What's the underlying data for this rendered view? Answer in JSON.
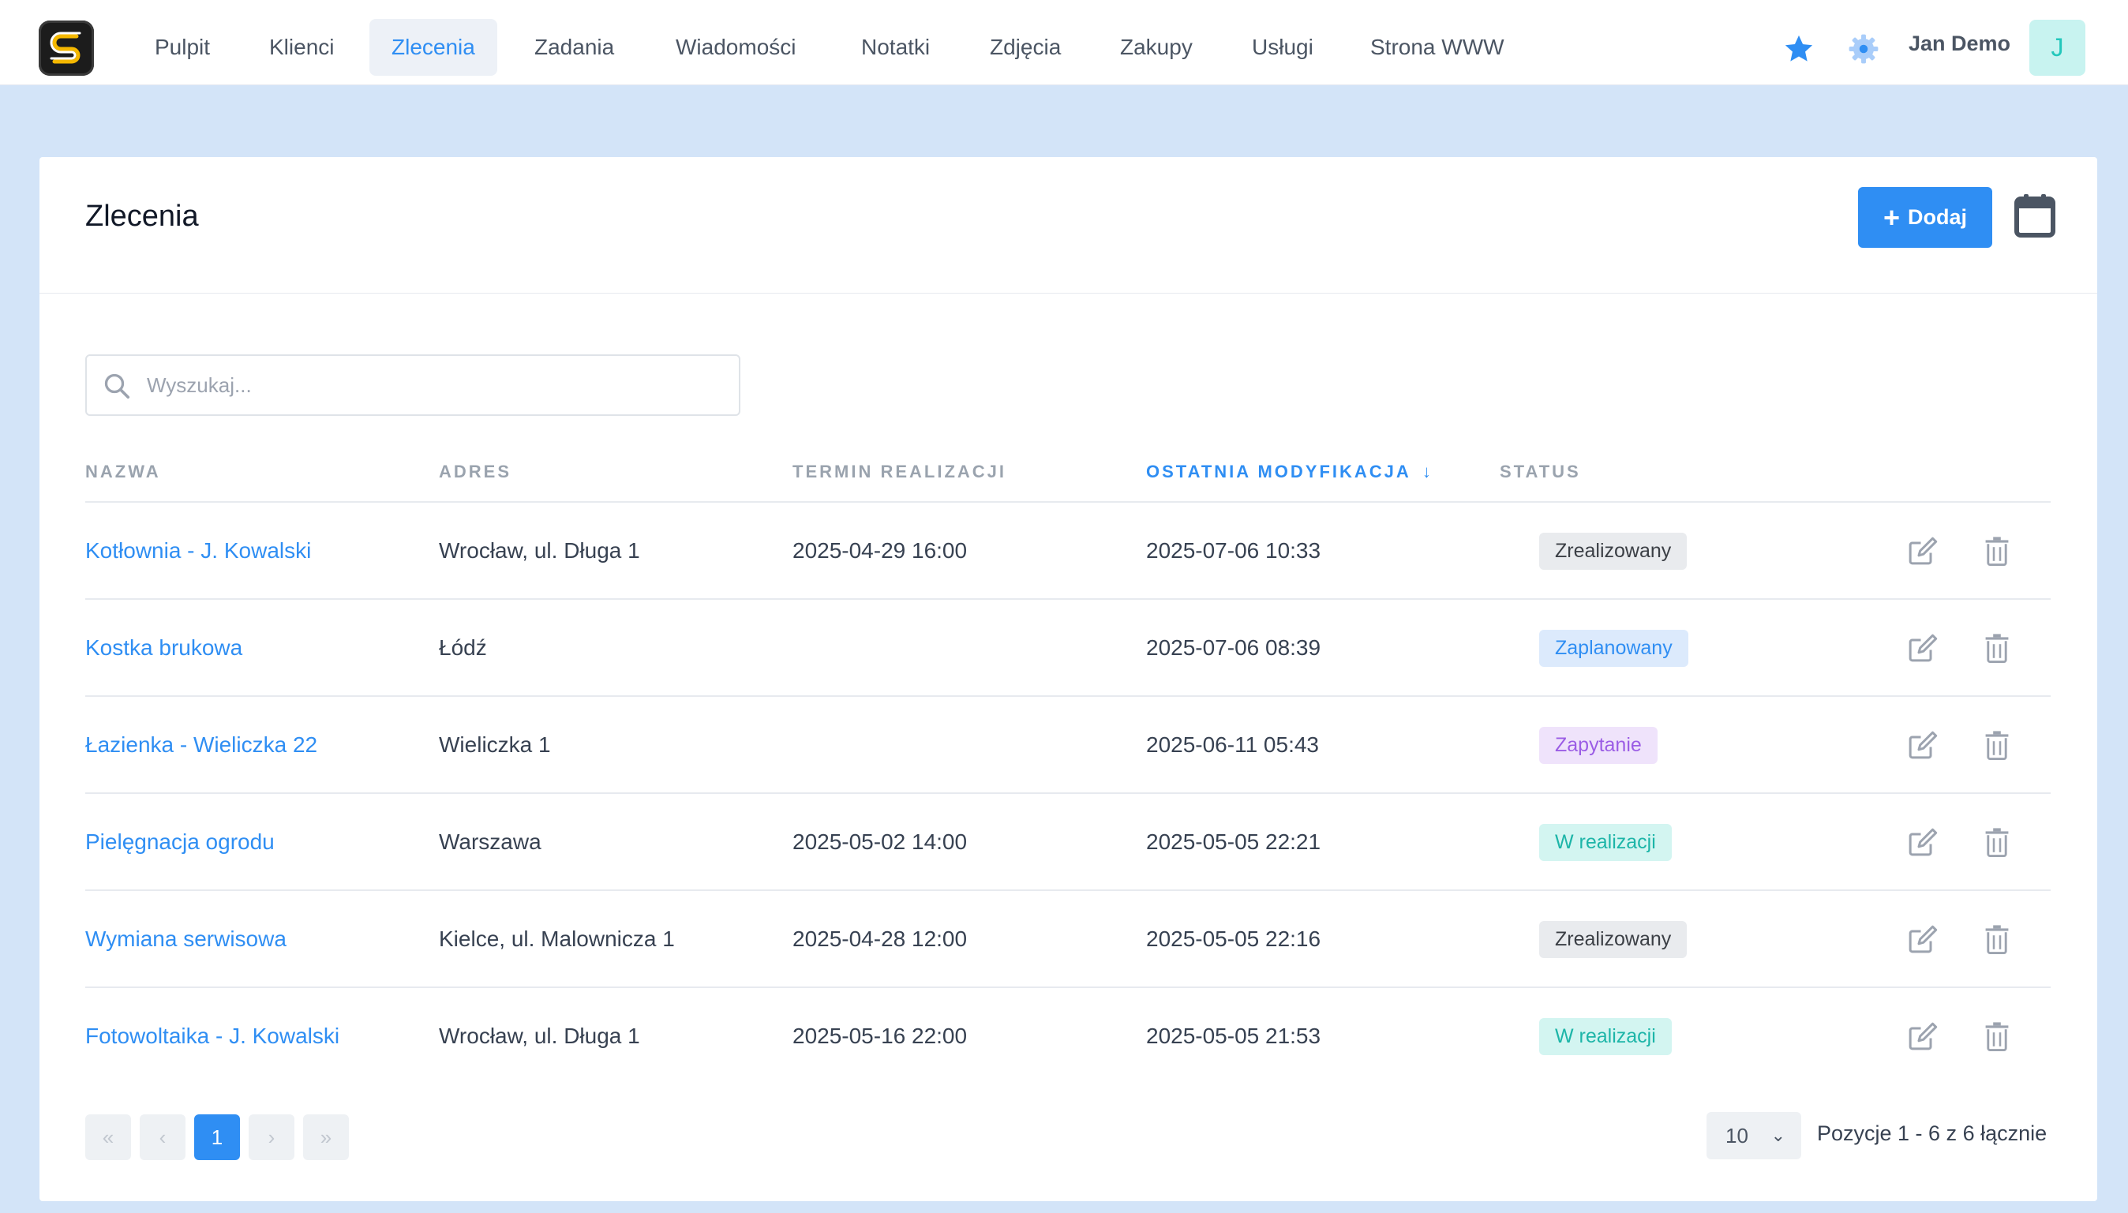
{
  "nav": {
    "items": [
      {
        "label": "Pulpit",
        "active": false
      },
      {
        "label": "Klienci",
        "active": false
      },
      {
        "label": "Zlecenia",
        "active": true
      },
      {
        "label": "Zadania",
        "active": false
      },
      {
        "label": "Wiadomości",
        "active": false
      },
      {
        "label": "Notatki",
        "active": false
      },
      {
        "label": "Zdjęcia",
        "active": false
      },
      {
        "label": "Zakupy",
        "active": false
      },
      {
        "label": "Usługi",
        "active": false
      },
      {
        "label": "Strona WWW",
        "active": false
      }
    ],
    "user_name": "Jan Demo",
    "avatar_letter": "J",
    "icons": [
      "star-icon",
      "gear-icon"
    ]
  },
  "page": {
    "title": "Zlecenia",
    "add_label": "Dodaj",
    "search_placeholder": "Wyszukaj..."
  },
  "table": {
    "columns": [
      "NAZWA",
      "ADRES",
      "TERMIN REALIZACJI",
      "OSTATNIA MODYFIKACJA",
      "STATUS"
    ],
    "sorted_column": "OSTATNIA MODYFIKACJA",
    "rows": [
      {
        "name": "Kotłownia - J. Kowalski",
        "address": "Wrocław, ul. Długa 1",
        "term": "2025-04-29 16:00",
        "modified": "2025-07-06 10:33",
        "status": "Zrealizowany"
      },
      {
        "name": "Kostka brukowa",
        "address": "Łódź",
        "term": "",
        "modified": "2025-07-06 08:39",
        "status": "Zaplanowany"
      },
      {
        "name": "Łazienka - Wieliczka 22",
        "address": "Wieliczka 1",
        "term": "",
        "modified": "2025-06-11 05:43",
        "status": "Zapytanie"
      },
      {
        "name": "Pielęgnacja ogrodu",
        "address": "Warszawa",
        "term": "2025-05-02 14:00",
        "modified": "2025-05-05 22:21",
        "status": "W realizacji"
      },
      {
        "name": "Wymiana serwisowa",
        "address": "Kielce, ul. Malownicza 1",
        "term": "2025-04-28 12:00",
        "modified": "2025-05-05 22:16",
        "status": "Zrealizowany"
      },
      {
        "name": "Fotowoltaika - J. Kowalski",
        "address": "Wrocław, ul. Długa 1",
        "term": "2025-05-16 22:00",
        "modified": "2025-05-05 21:53",
        "status": "W realizacji"
      }
    ]
  },
  "pagination": {
    "first": "«",
    "prev": "‹",
    "current_page": "1",
    "next": "›",
    "last": "»",
    "page_size": "10",
    "info": "Pozycje 1 - 6 z 6 łącznie"
  },
  "colors": {
    "accent": "#2f8ef3",
    "background": "#d3e4f8",
    "status_zrealizowany": "#e9ebee",
    "status_zaplanowany": "#dceafc",
    "status_zapytanie": "#efe3fb",
    "status_w_realizacji": "#d3f5f1"
  }
}
